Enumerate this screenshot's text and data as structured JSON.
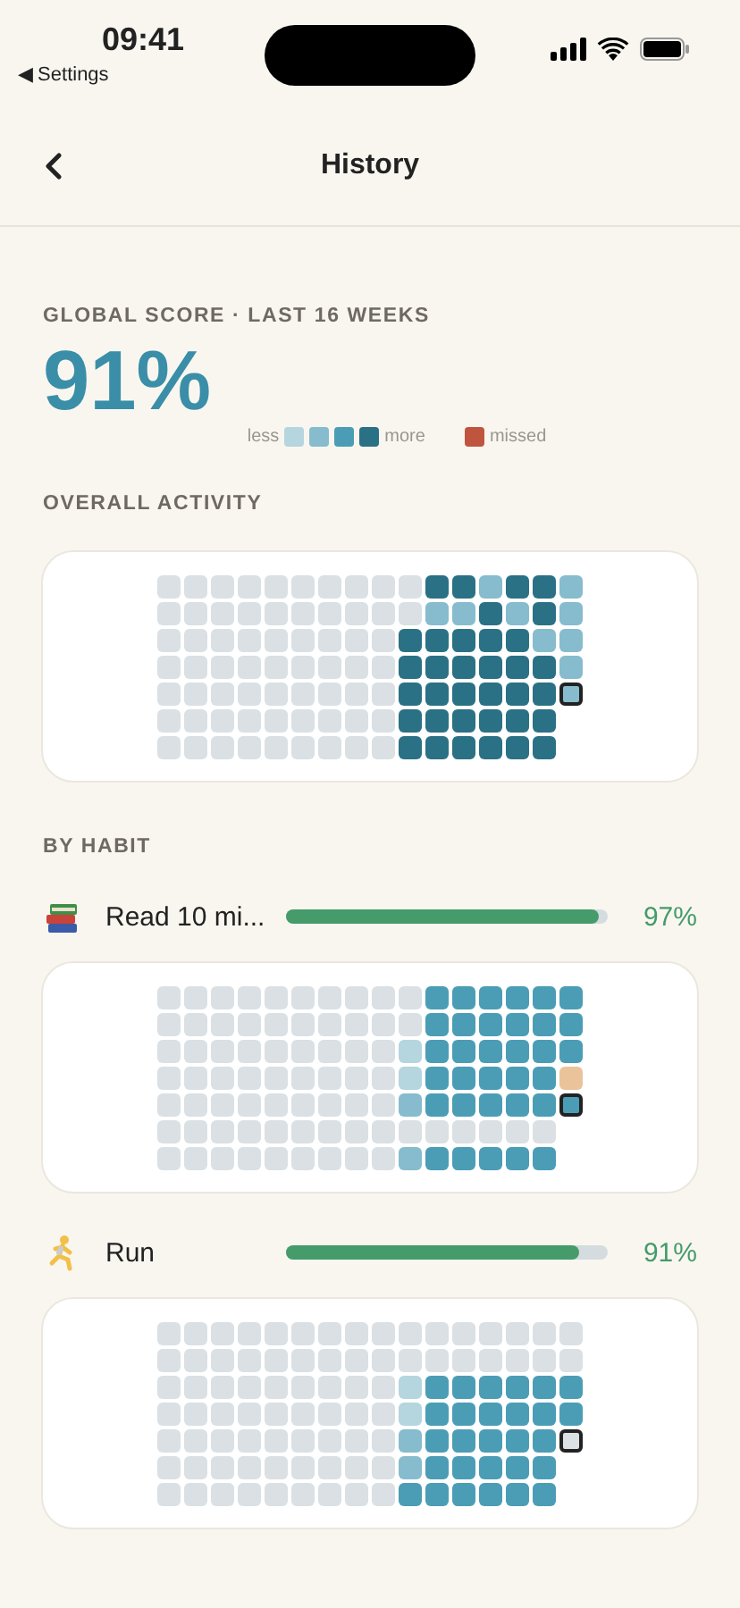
{
  "status_bar": {
    "time": "09:41",
    "back_label": "◀ Settings"
  },
  "nav": {
    "title": "History"
  },
  "score": {
    "label": "GLOBAL SCORE · LAST 16 WEEKS",
    "value": "91%",
    "legend": {
      "less": "less",
      "more": "more",
      "missed": "missed"
    }
  },
  "overall": {
    "title": "OVERALL ACTIVITY",
    "rows": [
      [
        {
          "kind": "empty"
        },
        {
          "kind": "empty"
        },
        {
          "kind": "empty"
        },
        {
          "kind": "empty"
        },
        {
          "kind": "empty"
        },
        {
          "kind": "empty"
        },
        {
          "kind": "empty"
        },
        {
          "kind": "empty"
        },
        {
          "kind": "empty"
        },
        {
          "kind": "empty"
        },
        {
          "kind": "max"
        },
        {
          "kind": "max"
        },
        {
          "kind": "medium"
        },
        {
          "kind": "max"
        },
        {
          "kind": "max"
        },
        {
          "kind": "medium"
        }
      ],
      [
        {
          "kind": "empty"
        },
        {
          "kind": "empty"
        },
        {
          "kind": "empty"
        },
        {
          "kind": "empty"
        },
        {
          "kind": "empty"
        },
        {
          "kind": "empty"
        },
        {
          "kind": "empty"
        },
        {
          "kind": "empty"
        },
        {
          "kind": "empty"
        },
        {
          "kind": "empty"
        },
        {
          "kind": "medium"
        },
        {
          "kind": "medium"
        },
        {
          "kind": "max"
        },
        {
          "kind": "medium"
        },
        {
          "kind": "max"
        },
        {
          "kind": "medium"
        }
      ],
      [
        {
          "kind": "empty"
        },
        {
          "kind": "empty"
        },
        {
          "kind": "empty"
        },
        {
          "kind": "empty"
        },
        {
          "kind": "empty"
        },
        {
          "kind": "empty"
        },
        {
          "kind": "empty"
        },
        {
          "kind": "empty"
        },
        {
          "kind": "empty"
        },
        {
          "kind": "max"
        },
        {
          "kind": "max"
        },
        {
          "kind": "max"
        },
        {
          "kind": "max"
        },
        {
          "kind": "max"
        },
        {
          "kind": "medium"
        },
        {
          "kind": "medium"
        }
      ],
      [
        {
          "kind": "empty"
        },
        {
          "kind": "empty"
        },
        {
          "kind": "empty"
        },
        {
          "kind": "empty"
        },
        {
          "kind": "empty"
        },
        {
          "kind": "empty"
        },
        {
          "kind": "empty"
        },
        {
          "kind": "empty"
        },
        {
          "kind": "empty"
        },
        {
          "kind": "max"
        },
        {
          "kind": "max"
        },
        {
          "kind": "max"
        },
        {
          "kind": "max"
        },
        {
          "kind": "max"
        },
        {
          "kind": "max"
        },
        {
          "kind": "medium"
        }
      ],
      [
        {
          "kind": "empty"
        },
        {
          "kind": "empty"
        },
        {
          "kind": "empty"
        },
        {
          "kind": "empty"
        },
        {
          "kind": "empty"
        },
        {
          "kind": "empty"
        },
        {
          "kind": "empty"
        },
        {
          "kind": "empty"
        },
        {
          "kind": "empty"
        },
        {
          "kind": "max"
        },
        {
          "kind": "max"
        },
        {
          "kind": "max"
        },
        {
          "kind": "max"
        },
        {
          "kind": "max"
        },
        {
          "kind": "max"
        },
        {
          "kind": "medium",
          "today": true
        }
      ],
      [
        {
          "kind": "empty"
        },
        {
          "kind": "empty"
        },
        {
          "kind": "empty"
        },
        {
          "kind": "empty"
        },
        {
          "kind": "empty"
        },
        {
          "kind": "empty"
        },
        {
          "kind": "empty"
        },
        {
          "kind": "empty"
        },
        {
          "kind": "empty"
        },
        {
          "kind": "max"
        },
        {
          "kind": "max"
        },
        {
          "kind": "max"
        },
        {
          "kind": "max"
        },
        {
          "kind": "max"
        },
        {
          "kind": "max"
        }
      ],
      [
        {
          "kind": "empty"
        },
        {
          "kind": "empty"
        },
        {
          "kind": "empty"
        },
        {
          "kind": "empty"
        },
        {
          "kind": "empty"
        },
        {
          "kind": "empty"
        },
        {
          "kind": "empty"
        },
        {
          "kind": "empty"
        },
        {
          "kind": "empty"
        },
        {
          "kind": "max"
        },
        {
          "kind": "max"
        },
        {
          "kind": "max"
        },
        {
          "kind": "max"
        },
        {
          "kind": "max"
        },
        {
          "kind": "max"
        }
      ]
    ]
  },
  "by_habit": {
    "title": "BY HABIT",
    "habits": [
      {
        "kind": "reading",
        "name": "Read 10 mi...",
        "level": 0.97,
        "percent": "97%",
        "rows": [
          [
            {
              "kind": "empty"
            },
            {
              "kind": "empty"
            },
            {
              "kind": "empty"
            },
            {
              "kind": "empty"
            },
            {
              "kind": "empty"
            },
            {
              "kind": "empty"
            },
            {
              "kind": "empty"
            },
            {
              "kind": "empty"
            },
            {
              "kind": "empty"
            },
            {
              "kind": "empty"
            },
            {
              "kind": "high"
            },
            {
              "kind": "high"
            },
            {
              "kind": "high"
            },
            {
              "kind": "high"
            },
            {
              "kind": "high"
            },
            {
              "kind": "high"
            }
          ],
          [
            {
              "kind": "empty"
            },
            {
              "kind": "empty"
            },
            {
              "kind": "empty"
            },
            {
              "kind": "empty"
            },
            {
              "kind": "empty"
            },
            {
              "kind": "empty"
            },
            {
              "kind": "empty"
            },
            {
              "kind": "empty"
            },
            {
              "kind": "empty"
            },
            {
              "kind": "empty"
            },
            {
              "kind": "high"
            },
            {
              "kind": "high"
            },
            {
              "kind": "high"
            },
            {
              "kind": "high"
            },
            {
              "kind": "high"
            },
            {
              "kind": "high"
            }
          ],
          [
            {
              "kind": "empty"
            },
            {
              "kind": "empty"
            },
            {
              "kind": "empty"
            },
            {
              "kind": "empty"
            },
            {
              "kind": "empty"
            },
            {
              "kind": "empty"
            },
            {
              "kind": "empty"
            },
            {
              "kind": "empty"
            },
            {
              "kind": "empty"
            },
            {
              "kind": "low"
            },
            {
              "kind": "high"
            },
            {
              "kind": "high"
            },
            {
              "kind": "high"
            },
            {
              "kind": "high"
            },
            {
              "kind": "high"
            },
            {
              "kind": "high"
            }
          ],
          [
            {
              "kind": "empty"
            },
            {
              "kind": "empty"
            },
            {
              "kind": "empty"
            },
            {
              "kind": "empty"
            },
            {
              "kind": "empty"
            },
            {
              "kind": "empty"
            },
            {
              "kind": "empty"
            },
            {
              "kind": "empty"
            },
            {
              "kind": "empty"
            },
            {
              "kind": "low"
            },
            {
              "kind": "high"
            },
            {
              "kind": "high"
            },
            {
              "kind": "high"
            },
            {
              "kind": "high"
            },
            {
              "kind": "high"
            },
            {
              "kind": "partial"
            }
          ],
          [
            {
              "kind": "empty"
            },
            {
              "kind": "empty"
            },
            {
              "kind": "empty"
            },
            {
              "kind": "empty"
            },
            {
              "kind": "empty"
            },
            {
              "kind": "empty"
            },
            {
              "kind": "empty"
            },
            {
              "kind": "empty"
            },
            {
              "kind": "empty"
            },
            {
              "kind": "medium"
            },
            {
              "kind": "high"
            },
            {
              "kind": "high"
            },
            {
              "kind": "high"
            },
            {
              "kind": "high"
            },
            {
              "kind": "high"
            },
            {
              "kind": "high",
              "today": true
            }
          ],
          [
            {
              "kind": "empty"
            },
            {
              "kind": "empty"
            },
            {
              "kind": "empty"
            },
            {
              "kind": "empty"
            },
            {
              "kind": "empty"
            },
            {
              "kind": "empty"
            },
            {
              "kind": "empty"
            },
            {
              "kind": "empty"
            },
            {
              "kind": "empty"
            },
            {
              "kind": "empty"
            },
            {
              "kind": "empty"
            },
            {
              "kind": "empty"
            },
            {
              "kind": "empty"
            },
            {
              "kind": "empty"
            },
            {
              "kind": "empty"
            }
          ],
          [
            {
              "kind": "empty"
            },
            {
              "kind": "empty"
            },
            {
              "kind": "empty"
            },
            {
              "kind": "empty"
            },
            {
              "kind": "empty"
            },
            {
              "kind": "empty"
            },
            {
              "kind": "empty"
            },
            {
              "kind": "empty"
            },
            {
              "kind": "empty"
            },
            {
              "kind": "medium"
            },
            {
              "kind": "high"
            },
            {
              "kind": "high"
            },
            {
              "kind": "high"
            },
            {
              "kind": "high"
            },
            {
              "kind": "high"
            }
          ]
        ]
      },
      {
        "kind": "running",
        "name": "Run",
        "level": 0.91,
        "percent": "91%",
        "rows": [
          [
            {
              "kind": "empty"
            },
            {
              "kind": "empty"
            },
            {
              "kind": "empty"
            },
            {
              "kind": "empty"
            },
            {
              "kind": "empty"
            },
            {
              "kind": "empty"
            },
            {
              "kind": "empty"
            },
            {
              "kind": "empty"
            },
            {
              "kind": "empty"
            },
            {
              "kind": "empty"
            },
            {
              "kind": "empty"
            },
            {
              "kind": "empty"
            },
            {
              "kind": "empty"
            },
            {
              "kind": "empty"
            },
            {
              "kind": "empty"
            },
            {
              "kind": "empty"
            }
          ],
          [
            {
              "kind": "empty"
            },
            {
              "kind": "empty"
            },
            {
              "kind": "empty"
            },
            {
              "kind": "empty"
            },
            {
              "kind": "empty"
            },
            {
              "kind": "empty"
            },
            {
              "kind": "empty"
            },
            {
              "kind": "empty"
            },
            {
              "kind": "empty"
            },
            {
              "kind": "empty"
            },
            {
              "kind": "empty"
            },
            {
              "kind": "empty"
            },
            {
              "kind": "empty"
            },
            {
              "kind": "empty"
            },
            {
              "kind": "empty"
            },
            {
              "kind": "empty"
            }
          ],
          [
            {
              "kind": "empty"
            },
            {
              "kind": "empty"
            },
            {
              "kind": "empty"
            },
            {
              "kind": "empty"
            },
            {
              "kind": "empty"
            },
            {
              "kind": "empty"
            },
            {
              "kind": "empty"
            },
            {
              "kind": "empty"
            },
            {
              "kind": "empty"
            },
            {
              "kind": "low"
            },
            {
              "kind": "high"
            },
            {
              "kind": "high"
            },
            {
              "kind": "high"
            },
            {
              "kind": "high"
            },
            {
              "kind": "high"
            },
            {
              "kind": "high"
            }
          ],
          [
            {
              "kind": "empty"
            },
            {
              "kind": "empty"
            },
            {
              "kind": "empty"
            },
            {
              "kind": "empty"
            },
            {
              "kind": "empty"
            },
            {
              "kind": "empty"
            },
            {
              "kind": "empty"
            },
            {
              "kind": "empty"
            },
            {
              "kind": "empty"
            },
            {
              "kind": "low"
            },
            {
              "kind": "high"
            },
            {
              "kind": "high"
            },
            {
              "kind": "high"
            },
            {
              "kind": "high"
            },
            {
              "kind": "high"
            },
            {
              "kind": "high"
            }
          ],
          [
            {
              "kind": "empty"
            },
            {
              "kind": "empty"
            },
            {
              "kind": "empty"
            },
            {
              "kind": "empty"
            },
            {
              "kind": "empty"
            },
            {
              "kind": "empty"
            },
            {
              "kind": "empty"
            },
            {
              "kind": "empty"
            },
            {
              "kind": "empty"
            },
            {
              "kind": "medium"
            },
            {
              "kind": "high"
            },
            {
              "kind": "high"
            },
            {
              "kind": "high"
            },
            {
              "kind": "high"
            },
            {
              "kind": "high"
            },
            {
              "kind": "empty",
              "today": true
            }
          ],
          [
            {
              "kind": "empty"
            },
            {
              "kind": "empty"
            },
            {
              "kind": "empty"
            },
            {
              "kind": "empty"
            },
            {
              "kind": "empty"
            },
            {
              "kind": "empty"
            },
            {
              "kind": "empty"
            },
            {
              "kind": "empty"
            },
            {
              "kind": "empty"
            },
            {
              "kind": "medium"
            },
            {
              "kind": "high"
            },
            {
              "kind": "high"
            },
            {
              "kind": "high"
            },
            {
              "kind": "high"
            },
            {
              "kind": "high"
            }
          ],
          [
            {
              "kind": "empty"
            },
            {
              "kind": "empty"
            },
            {
              "kind": "empty"
            },
            {
              "kind": "empty"
            },
            {
              "kind": "empty"
            },
            {
              "kind": "empty"
            },
            {
              "kind": "empty"
            },
            {
              "kind": "empty"
            },
            {
              "kind": "empty"
            },
            {
              "kind": "high"
            },
            {
              "kind": "high"
            },
            {
              "kind": "high"
            },
            {
              "kind": "high"
            },
            {
              "kind": "high"
            },
            {
              "kind": "high"
            }
          ]
        ]
      }
    ]
  }
}
